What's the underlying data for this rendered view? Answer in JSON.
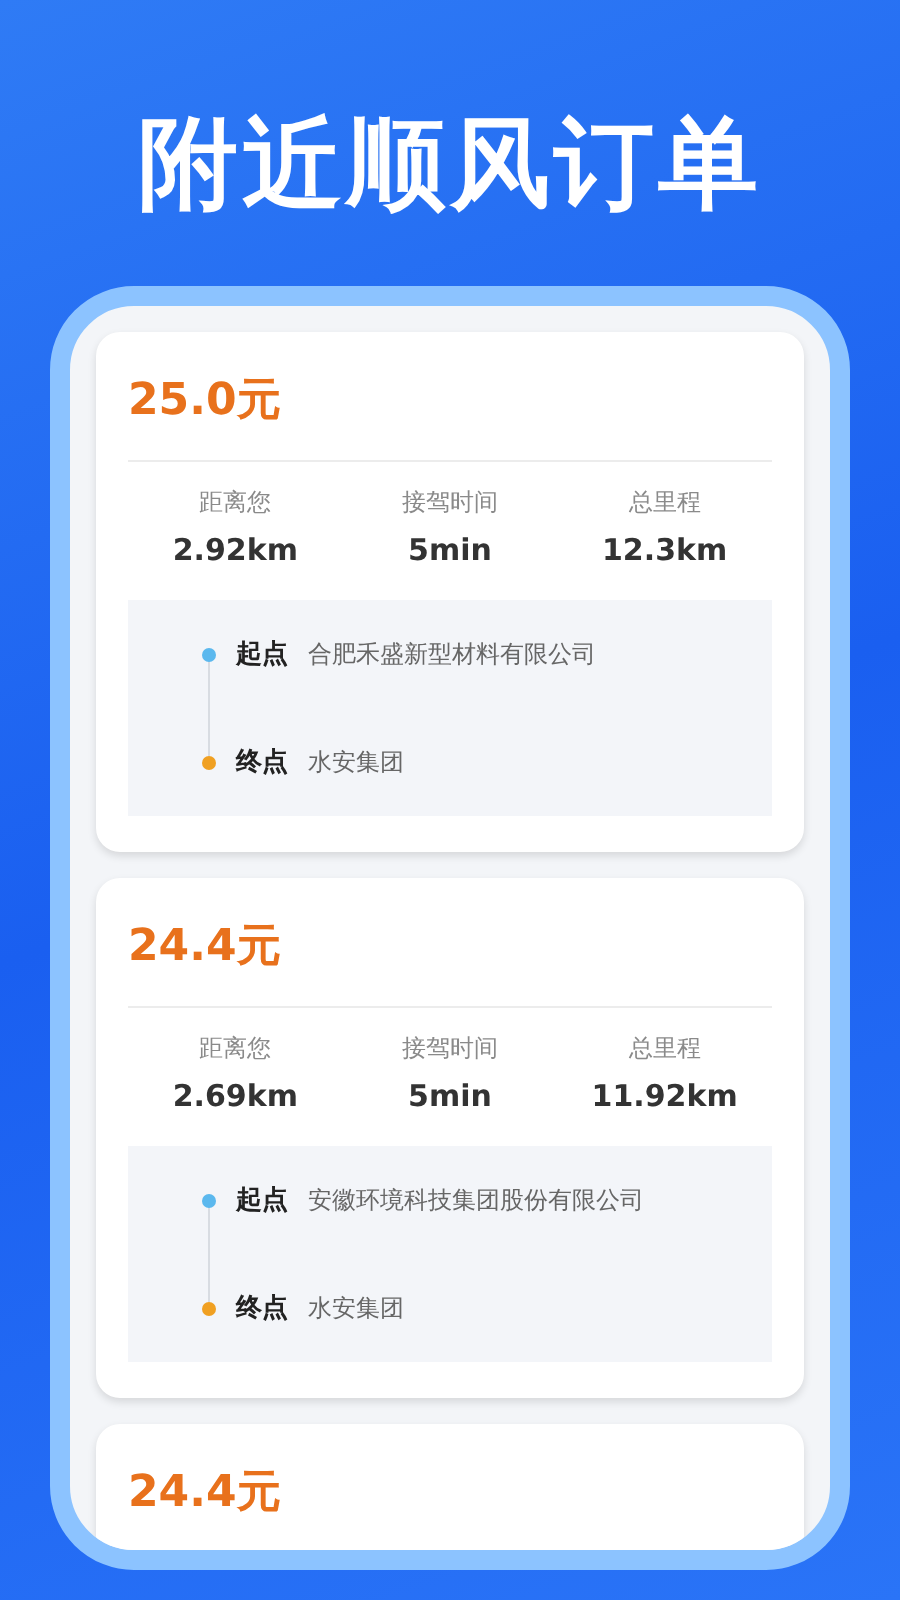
{
  "headline": "附近顺风订单",
  "orders": [
    {
      "price": "25.0元",
      "stats": [
        {
          "label": "距离您",
          "value": "2.92km"
        },
        {
          "label": "接驾时间",
          "value": "5min"
        },
        {
          "label": "总里程",
          "value": "12.3km"
        }
      ],
      "route": [
        {
          "kind": "start",
          "tag": "起点",
          "place": "合肥禾盛新型材料有限公司"
        },
        {
          "kind": "end",
          "tag": "终点",
          "place": "水安集团"
        }
      ]
    },
    {
      "price": "24.4元",
      "stats": [
        {
          "label": "距离您",
          "value": "2.69km"
        },
        {
          "label": "接驾时间",
          "value": "5min"
        },
        {
          "label": "总里程",
          "value": "11.92km"
        }
      ],
      "route": [
        {
          "kind": "start",
          "tag": "起点",
          "place": "安徽环境科技集团股份有限公司"
        },
        {
          "kind": "end",
          "tag": "终点",
          "place": "水安集团"
        }
      ]
    },
    {
      "price": "24.4元"
    }
  ]
}
